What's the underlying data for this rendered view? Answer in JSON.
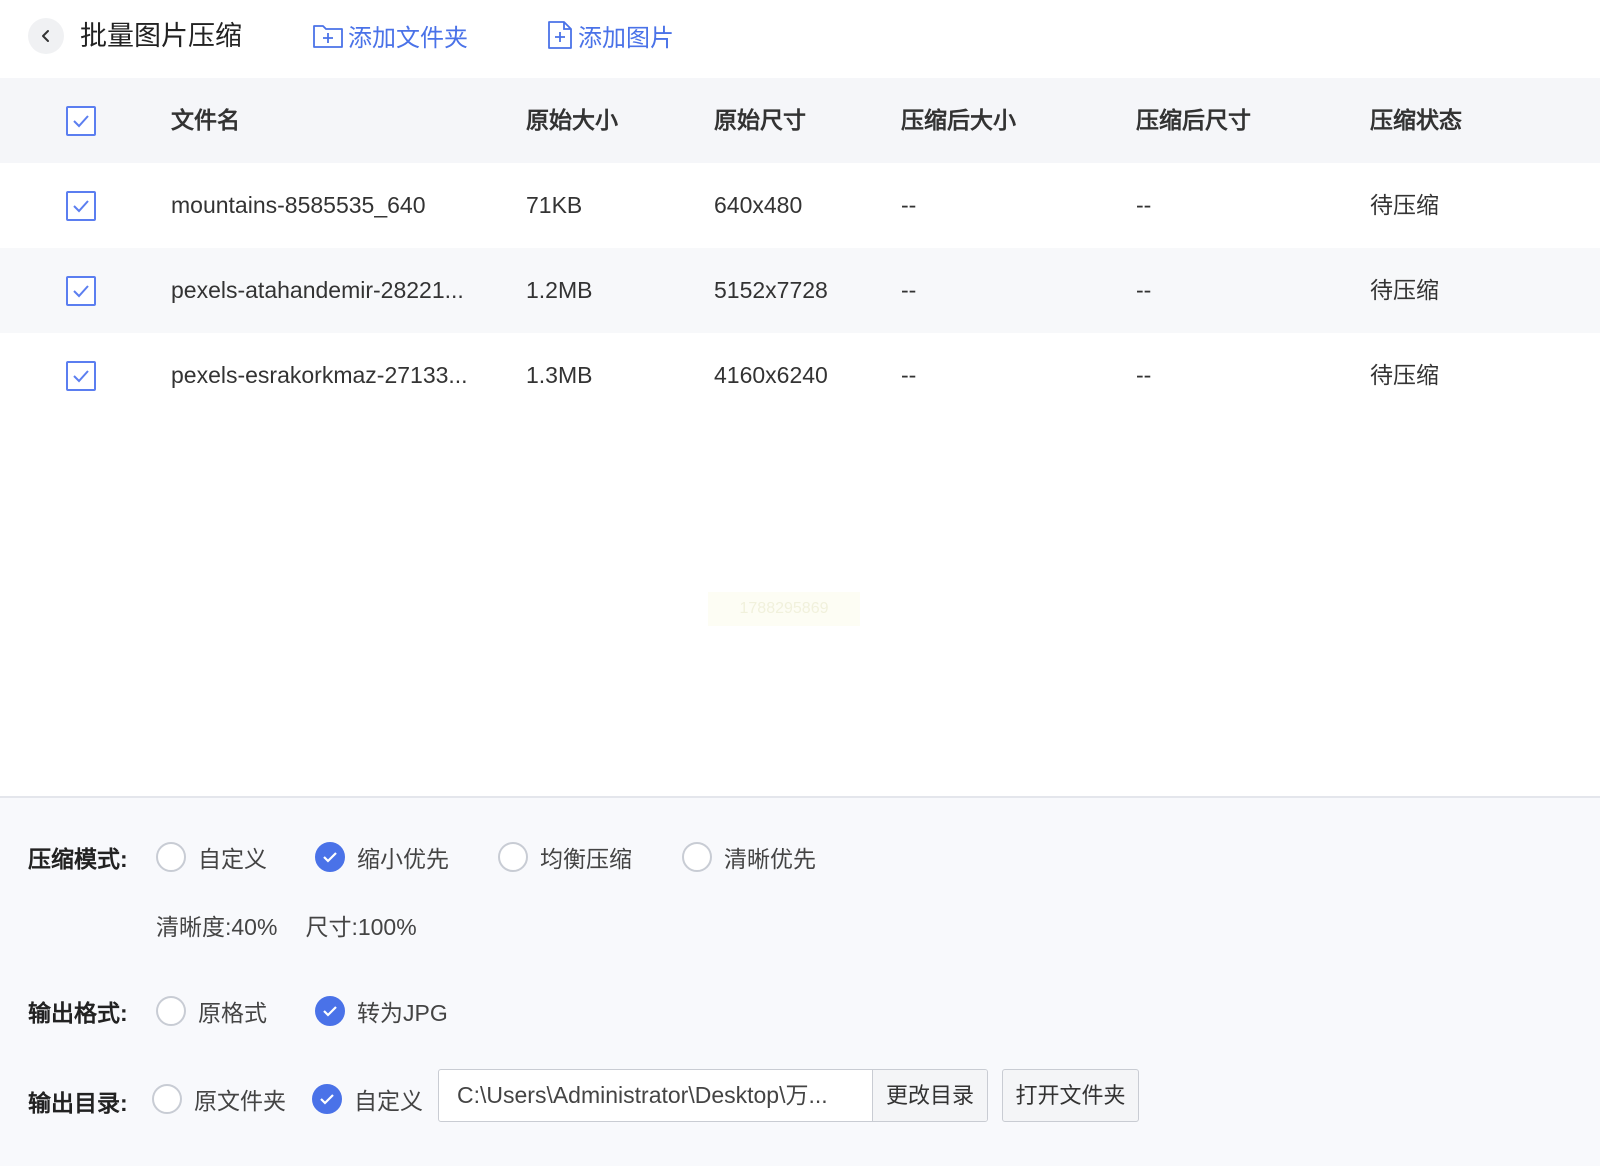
{
  "header": {
    "title": "批量图片压缩",
    "add_folder_label": "添加文件夹",
    "add_image_label": "添加图片"
  },
  "table": {
    "columns": [
      "文件名",
      "原始大小",
      "原始尺寸",
      "压缩后大小",
      "压缩后尺寸",
      "压缩状态"
    ],
    "rows": [
      {
        "name": "mountains-8585535_640",
        "orig_size": "71KB",
        "orig_dim": "640x480",
        "comp_size": "--",
        "comp_dim": "--",
        "status": "待压缩",
        "checked": true
      },
      {
        "name": "pexels-atahandemir-28221...",
        "orig_size": "1.2MB",
        "orig_dim": "5152x7728",
        "comp_size": "--",
        "comp_dim": "--",
        "status": "待压缩",
        "checked": true
      },
      {
        "name": "pexels-esrakorkmaz-27133...",
        "orig_size": "1.3MB",
        "orig_dim": "4160x6240",
        "comp_size": "--",
        "comp_dim": "--",
        "status": "待压缩",
        "checked": true
      }
    ],
    "select_all_checked": true
  },
  "watermark": "1788295869",
  "settings": {
    "mode_label": "压缩模式:",
    "mode_options": [
      "自定义",
      "缩小优先",
      "均衡压缩",
      "清晰优先"
    ],
    "mode_selected": "缩小优先",
    "clarity": "清晰度:40%",
    "size": "尺寸:100%",
    "format_label": "输出格式:",
    "format_options": [
      "原格式",
      "转为JPG"
    ],
    "format_selected": "转为JPG",
    "output_label": "输出目录:",
    "output_options": [
      "原文件夹",
      "自定义"
    ],
    "output_selected": "自定义",
    "output_path": "C:\\Users\\Administrator\\Desktop\\万...",
    "change_dir_label": "更改目录",
    "open_folder_label": "打开文件夹"
  },
  "colors": {
    "accent": "#4a72e8",
    "header_row_bg": "#f5f6f9",
    "panel_bg": "#f8f9fc"
  }
}
